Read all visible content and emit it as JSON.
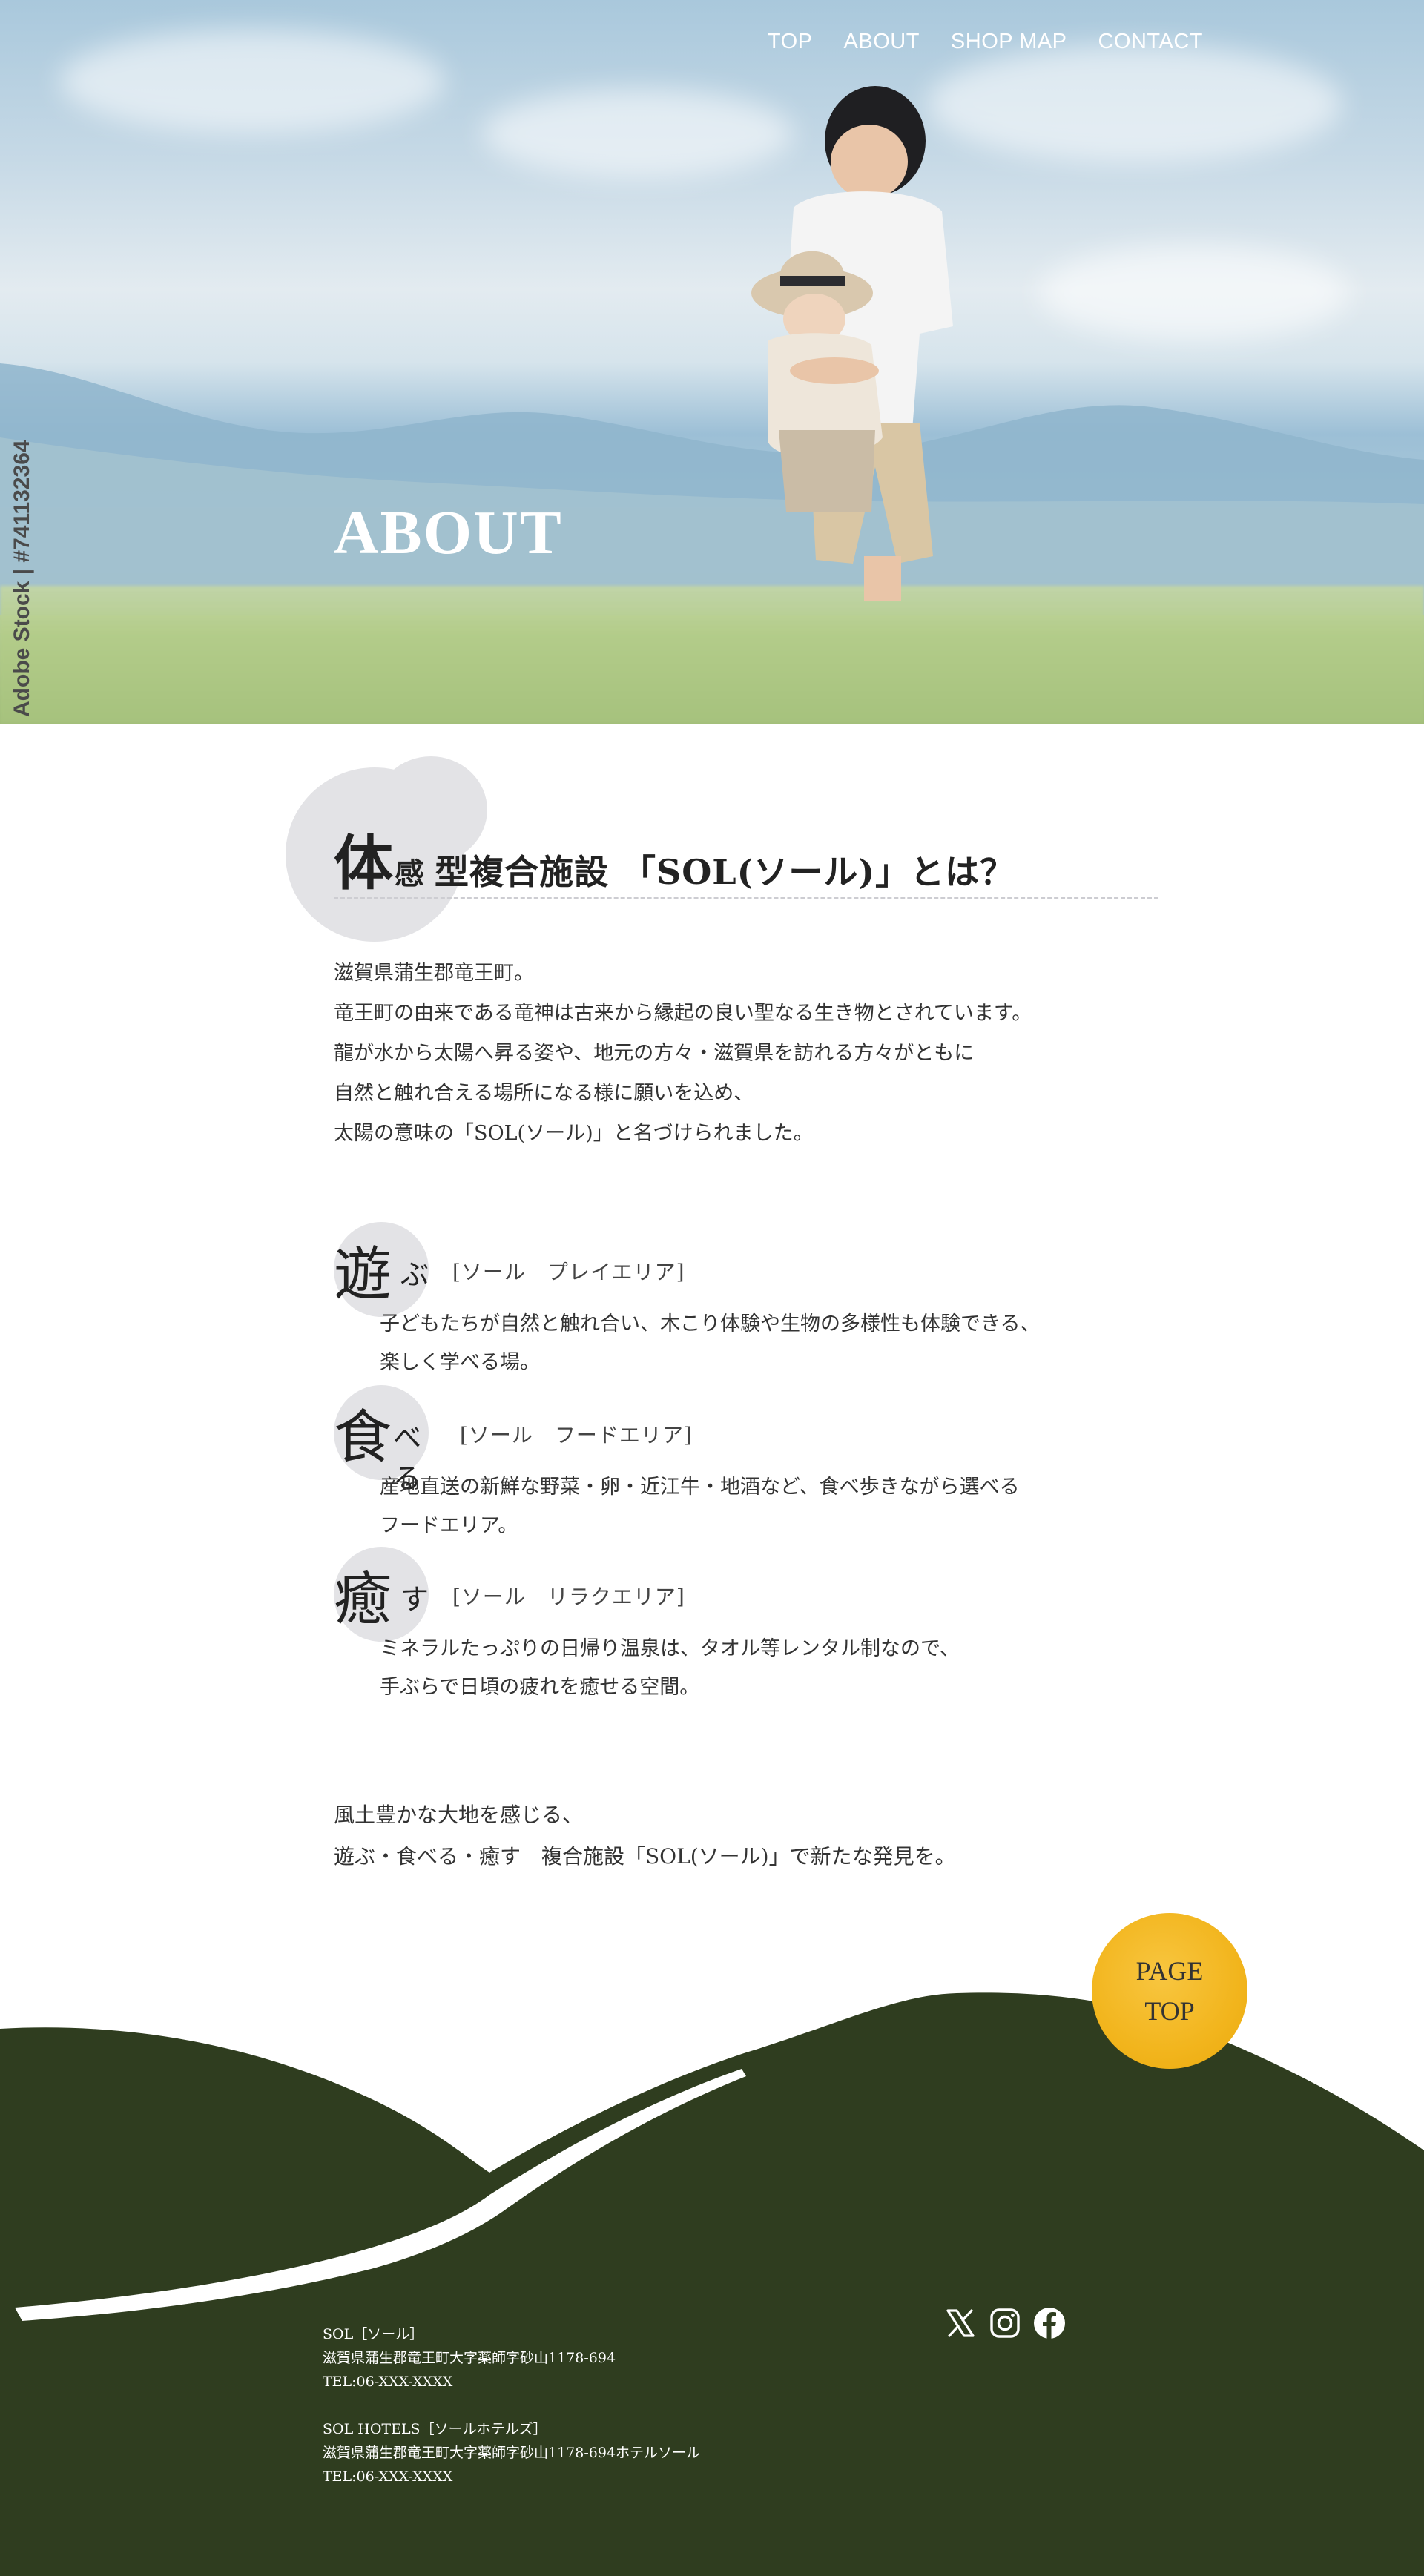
{
  "nav": {
    "items": [
      "TOP",
      "ABOUT",
      "SHOP MAP",
      "CONTACT"
    ]
  },
  "hero": {
    "title": "ABOUT",
    "watermark": "Adobe Stock | #741132364"
  },
  "about": {
    "heading_big": "体",
    "heading_small": "感",
    "heading_rest": "型複合施設 「SOL(ソール)」とは？",
    "intro": [
      "滋賀県蒲生郡竜王町。",
      "竜王町の由来である竜神は古来から縁起の良い聖なる生き物とされています。",
      "龍が水から太陽へ昇る姿や、地元の方々・滋賀県を訪れる方々がともに",
      "自然と触れ合える場所になる様に願いを込め、",
      "太陽の意味の「SOL(ソール)」と名づけられました。"
    ],
    "areas": [
      {
        "kanji": "遊",
        "kana": "ぶ",
        "tag": "[ソール　プレイエリア]",
        "lines": [
          "子どもたちが自然と触れ合い、木こり体験や生物の多様性も体験できる、",
          "楽しく学べる場。"
        ]
      },
      {
        "kanji": "食",
        "kana": "べる",
        "tag": "[ソール　フードエリア]",
        "lines": [
          "産地直送の新鮮な野菜・卵・近江牛・地酒など、食べ歩きながら選べる",
          "フードエリア。"
        ]
      },
      {
        "kanji": "癒",
        "kana": "す",
        "tag": "[ソール　リラクエリア]",
        "lines": [
          "ミネラルたっぷりの日帰り温泉は、タオル等レンタル制なので、",
          "手ぶらで日頃の疲れを癒せる空間。"
        ]
      }
    ],
    "closing": [
      "風土豊かな大地を感じる、",
      "遊ぶ・食べる・癒す　複合施設「SOL(ソール)」で新たな発見を。"
    ]
  },
  "pagetop": {
    "line1": "PAGE",
    "line2": "TOP"
  },
  "footer": {
    "sol": {
      "name": "SOL［ソール］",
      "address": "滋賀県蒲生郡竜王町大字薬師字砂山1178-694",
      "tel": "TEL:06-XXX-XXXX"
    },
    "hotels": {
      "name": "SOL HOTELS［ソールホテルズ］",
      "address": "滋賀県蒲生郡竜王町大字薬師字砂山1178-694ホテルソール",
      "tel": "TEL:06-XXX-XXXX"
    },
    "social": [
      "x-icon",
      "instagram-icon",
      "facebook-icon"
    ]
  },
  "colors": {
    "forest": "#2f3d1f",
    "accent_yellow": "#f2b51d",
    "blob_gray": "#e3e3e6"
  }
}
